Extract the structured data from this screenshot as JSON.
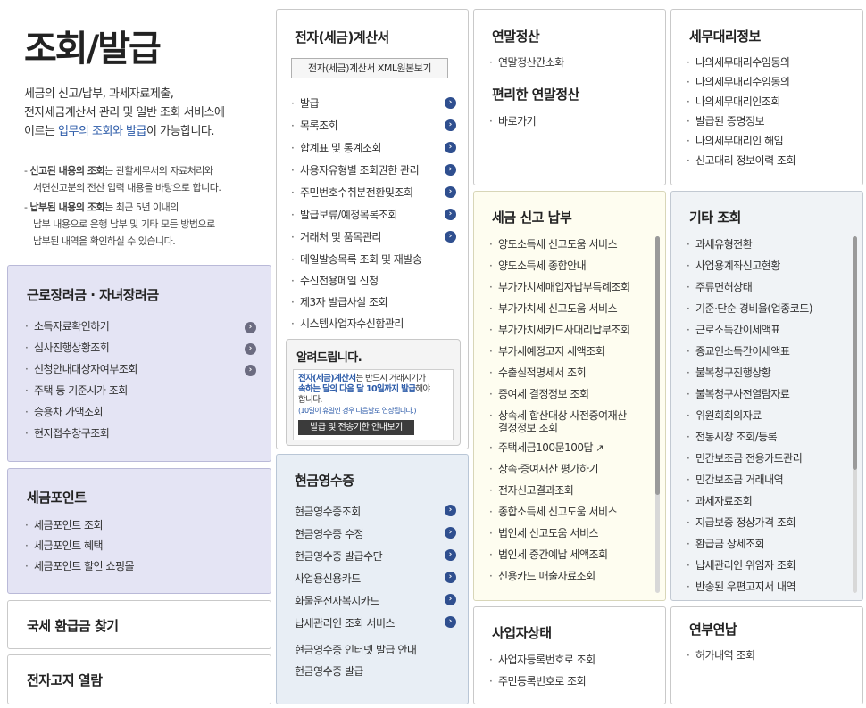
{
  "intro": {
    "heading": "조회/발급",
    "desc1_a": "세금의 신고/납부, 과세자료제출,",
    "desc1_b": "전자세금계산서 관리 및 일반 조회 서비스에",
    "desc1_c_pre": "이르는 ",
    "desc1_c_link": "업무의 조회와 발급",
    "desc1_c_post": "이 가능합니다.",
    "note1_bold": "신고된 내용의 조회",
    "note1_rest": "는 관할세무서의 자료처리와",
    "note1_line2": "서면신고분의 전산 입력 내용을 바탕으로 합니다.",
    "note2_bold": "납부된 내용의 조회",
    "note2_rest": "는 최근 5년 이내의",
    "note2_line2": "납부 내용으로 은행 납부 및 기타 모든 방법으로",
    "note2_line3": "납부된 내역을 확인하실 수 있습니다."
  },
  "earned": {
    "title": "근로장려금 · 자녀장려금",
    "items": [
      "소득자료확인하기",
      "심사진행상황조회",
      "신청안내대상자여부조회",
      "주택 등 기준시가 조회",
      "승용차 가액조회",
      "현지접수창구조회"
    ]
  },
  "point": {
    "title": "세금포인트",
    "items": [
      "세금포인트 조회",
      "세금포인트 혜택",
      "세금포인트 할인 쇼핑몰"
    ]
  },
  "refund": {
    "title": "국세 환급금 찾기"
  },
  "notice": {
    "title": "전자고지 열람"
  },
  "einvoice": {
    "title": "전자(세금)계산서",
    "xml_button": "전자(세금)계산서 XML원본보기",
    "items": [
      "발급",
      "목록조회",
      "합계표 및 통계조회",
      "사용자유형별 조회권한 관리",
      "주민번호수취분전환및조회",
      "발급보류/예정목록조회",
      "거래처 및 품목관리",
      "메일발송목록 조회 및 재발송",
      "수신전용메일 신청",
      "제3자 발급사실 조회",
      "시스템사업자수신함관리"
    ],
    "alert_title": "알려드립니다.",
    "alert_p1": "전자(세금)계산서",
    "alert_p2": "는 반드시 거래시기가",
    "alert_p3": "속하는 달의 다음 달 10일까지 발급",
    "alert_p4": "해야",
    "alert_p5": "합니다.",
    "alert_small": "(10일이 휴일인 경우 다음날로 연장됩니다.)",
    "alert_button": "발급 및 전송기한 안내보기"
  },
  "cash": {
    "title": "현금영수증",
    "items": [
      "현금영수증조회",
      "현금영수증 수정",
      "현금영수증 발급수단",
      "사업용신용카드",
      "화물운전자복지카드",
      "납세관리인 조회 서비스"
    ],
    "extra": [
      "현금영수증 인터넷 발급 안내",
      "현금영수증 발급"
    ]
  },
  "yearend": {
    "title": "연말정산",
    "items": [
      "연말정산간소화"
    ],
    "title2": "편리한 연말정산",
    "items2": [
      "바로가기"
    ]
  },
  "tax": {
    "title": "세금 신고 납부",
    "items": [
      "양도소득세 신고도움 서비스",
      "양도소득세 종합안내",
      "부가가치세매입자납부특례조회",
      "부가가치세 신고도움 서비스",
      "부가가치세카드사대리납부조회",
      "부가세예정고지 세액조회",
      "수출실적명세서 조회",
      "증여세 결정정보 조회",
      "상속세 합산대상 사전증여재산",
      "결정정보 조회",
      "주택세금100문100답",
      "상속·증여재산 평가하기",
      "전자신고결과조회",
      "종합소득세 신고도움 서비스",
      "법인세 신고도움 서비스",
      "법인세 중간예납 세액조회",
      "신용카드 매출자료조회"
    ]
  },
  "biz": {
    "title": "사업자상태",
    "items": [
      "사업자등록번호로 조회",
      "주민등록번호로 조회"
    ]
  },
  "agent": {
    "title": "세무대리정보",
    "items": [
      "나의세무대리수임동의",
      "나의세무대리수임동의",
      "나의세무대리인조회",
      "발급된 증명정보",
      "나의세무대리인 해임",
      "신고대리 정보이력 조회"
    ]
  },
  "etc": {
    "title": "기타 조회",
    "items": [
      "과세유형전환",
      "사업용계좌신고현황",
      "주류면허상태",
      "기준·단순 경비율(업종코드)",
      "근로소득간이세액표",
      "종교인소득간이세액표",
      "불복청구진행상황",
      "불복청구사전열람자료",
      "위원회회의자료",
      "전통시장 조회/등록",
      "민간보조금 전용카드관리",
      "민간보조금 거래내역",
      "과세자료조회",
      "지급보증 정상가격 조회",
      "환급금 상세조회",
      "납세관리인 위임자 조회",
      "반송된 우편고지서 내역"
    ]
  },
  "install": {
    "title": "연부연납",
    "items": [
      "허가내역 조회"
    ]
  },
  "colors": {
    "link": "#2b5aa8",
    "arrow": "#2f4f8f"
  }
}
